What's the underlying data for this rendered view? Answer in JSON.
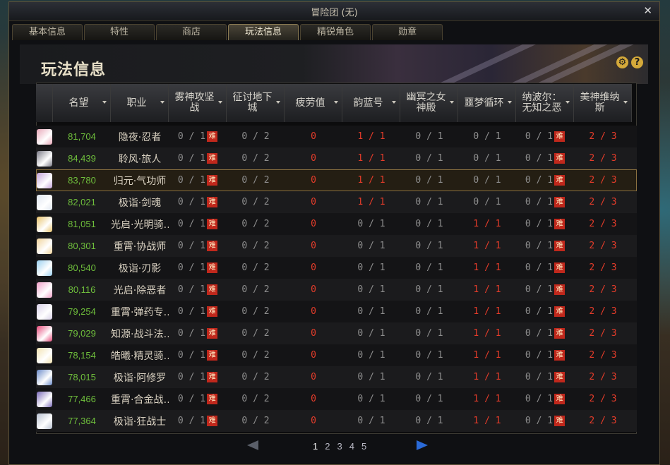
{
  "window": {
    "title": "冒险团 (无)",
    "close": "✕"
  },
  "tabs": [
    "基本信息",
    "特性",
    "商店",
    "玩法信息",
    "精锐角色",
    "勋章"
  ],
  "active_tab": 3,
  "page_title": "玩法信息",
  "icons": {
    "settings": "⚙",
    "help": "?"
  },
  "columns": [
    "名望",
    "职业",
    "雾神攻坚战",
    "征讨地下城",
    "疲劳值",
    "韵蓝号",
    "幽冥之女神殿",
    "噩梦循环",
    "纳波尔：无知之恶",
    "美神维纳斯"
  ],
  "nan_badge": "难",
  "rows": [
    {
      "avatar": "#e8a7b8",
      "fame": "81,704",
      "job": "隐夜·忍者",
      "fog": "0 / 1",
      "dungeon": "0 / 2",
      "fatigue": "0",
      "blue": "1 / 1",
      "blue_red": true,
      "temple": "0 / 1",
      "nightmare": "0 / 1",
      "nightmare_red": false,
      "nabol": "0 / 1",
      "venus": "2 / 3"
    },
    {
      "avatar": "#7a7a86",
      "fame": "84,439",
      "job": "聆风·旅人",
      "fog": "0 / 1",
      "dungeon": "0 / 2",
      "fatigue": "0",
      "blue": "1 / 1",
      "blue_red": true,
      "temple": "0 / 1",
      "nightmare": "0 / 1",
      "nightmare_red": false,
      "nabol": "0 / 1",
      "venus": "2 / 3"
    },
    {
      "avatar": "#c2a2d8",
      "fame": "83,780",
      "job": "归元·气功师",
      "fog": "0 / 1",
      "dungeon": "0 / 2",
      "fatigue": "0",
      "blue": "1 / 1",
      "blue_red": true,
      "temple": "0 / 1",
      "nightmare": "0 / 1",
      "nightmare_red": false,
      "nabol": "0 / 1",
      "venus": "2 / 3",
      "selected": true
    },
    {
      "avatar": "#dfe6f0",
      "fame": "82,021",
      "job": "极诣·剑魂",
      "fog": "0 / 1",
      "dungeon": "0 / 2",
      "fatigue": "0",
      "blue": "1 / 1",
      "blue_red": true,
      "temple": "0 / 1",
      "nightmare": "0 / 1",
      "nightmare_red": false,
      "nabol": "0 / 1",
      "venus": "2 / 3"
    },
    {
      "avatar": "#e8c26a",
      "fame": "81,051",
      "job": "光启·光明骑…",
      "fog": "0 / 1",
      "dungeon": "0 / 2",
      "fatigue": "0",
      "blue": "0 / 1",
      "blue_red": false,
      "temple": "0 / 1",
      "nightmare": "1 / 1",
      "nightmare_red": true,
      "nabol": "0 / 1",
      "venus": "2 / 3"
    },
    {
      "avatar": "#f0d39a",
      "fame": "80,301",
      "job": "重霄·协战师",
      "fog": "0 / 1",
      "dungeon": "0 / 2",
      "fatigue": "0",
      "blue": "0 / 1",
      "blue_red": false,
      "temple": "0 / 1",
      "nightmare": "1 / 1",
      "nightmare_red": true,
      "nabol": "0 / 1",
      "venus": "2 / 3"
    },
    {
      "avatar": "#9ad0f0",
      "fame": "80,540",
      "job": "极诣·刃影",
      "fog": "0 / 1",
      "dungeon": "0 / 2",
      "fatigue": "0",
      "blue": "0 / 1",
      "blue_red": false,
      "temple": "0 / 1",
      "nightmare": "1 / 1",
      "nightmare_red": true,
      "nabol": "0 / 1",
      "venus": "2 / 3"
    },
    {
      "avatar": "#f0a0c8",
      "fame": "80,116",
      "job": "光启·除恶者",
      "fog": "0 / 1",
      "dungeon": "0 / 2",
      "fatigue": "0",
      "blue": "0 / 1",
      "blue_red": false,
      "temple": "0 / 1",
      "nightmare": "1 / 1",
      "nightmare_red": true,
      "nabol": "0 / 1",
      "venus": "2 / 3"
    },
    {
      "avatar": "#d8d0e8",
      "fame": "79,254",
      "job": "重霄·弹药专…",
      "fog": "0 / 1",
      "dungeon": "0 / 2",
      "fatigue": "0",
      "blue": "0 / 1",
      "blue_red": false,
      "temple": "0 / 1",
      "nightmare": "1 / 1",
      "nightmare_red": true,
      "nabol": "0 / 1",
      "venus": "2 / 3"
    },
    {
      "avatar": "#e64a7a",
      "fame": "79,029",
      "job": "知源·战斗法…",
      "fog": "0 / 1",
      "dungeon": "0 / 2",
      "fatigue": "0",
      "blue": "0 / 1",
      "blue_red": false,
      "temple": "0 / 1",
      "nightmare": "1 / 1",
      "nightmare_red": true,
      "nabol": "0 / 1",
      "venus": "2 / 3"
    },
    {
      "avatar": "#f2e2b0",
      "fame": "78,154",
      "job": "皓曦·精灵骑…",
      "fog": "0 / 1",
      "dungeon": "0 / 2",
      "fatigue": "0",
      "blue": "0 / 1",
      "blue_red": false,
      "temple": "0 / 1",
      "nightmare": "1 / 1",
      "nightmare_red": true,
      "nabol": "0 / 1",
      "venus": "2 / 3"
    },
    {
      "avatar": "#6a8ac8",
      "fame": "78,015",
      "job": "极诣·阿修罗",
      "fog": "0 / 1",
      "dungeon": "0 / 2",
      "fatigue": "0",
      "blue": "0 / 1",
      "blue_red": false,
      "temple": "0 / 1",
      "nightmare": "1 / 1",
      "nightmare_red": true,
      "nabol": "0 / 1",
      "venus": "2 / 3"
    },
    {
      "avatar": "#7a6ab8",
      "fame": "77,466",
      "job": "重霄·合金战…",
      "fog": "0 / 1",
      "dungeon": "0 / 2",
      "fatigue": "0",
      "blue": "0 / 1",
      "blue_red": false,
      "temple": "0 / 1",
      "nightmare": "1 / 1",
      "nightmare_red": true,
      "nabol": "0 / 1",
      "venus": "2 / 3"
    },
    {
      "avatar": "#b8c0d0",
      "fame": "77,364",
      "job": "极诣·狂战士",
      "fog": "0 / 1",
      "dungeon": "0 / 2",
      "fatigue": "0",
      "blue": "0 / 1",
      "blue_red": false,
      "temple": "0 / 1",
      "nightmare": "1 / 1",
      "nightmare_red": true,
      "nabol": "0 / 1",
      "venus": "2 / 3"
    }
  ],
  "pagination": {
    "pages": [
      "1",
      "2",
      "3",
      "4",
      "5"
    ],
    "current": "1"
  }
}
